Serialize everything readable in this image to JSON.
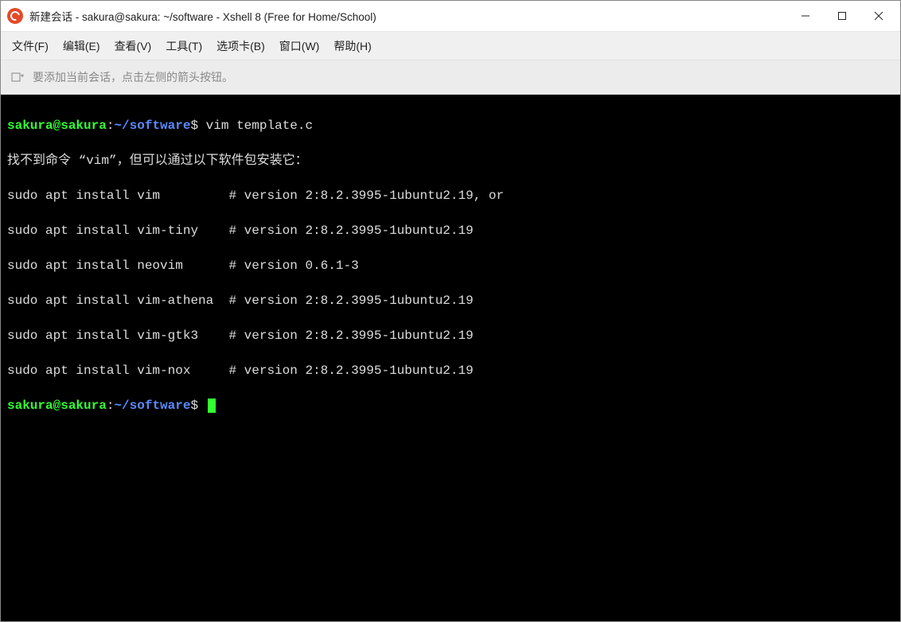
{
  "window": {
    "title": "新建会话 - sakura@sakura: ~/software - Xshell 8 (Free for Home/School)"
  },
  "menu": {
    "file": "文件(F)",
    "edit": "编辑(E)",
    "view": "查看(V)",
    "tools": "工具(T)",
    "tabs": "选项卡(B)",
    "window": "窗口(W)",
    "help": "帮助(H)"
  },
  "tabbar": {
    "hint": "要添加当前会话，点击左侧的箭头按钮。"
  },
  "prompt": {
    "userhost": "sakura@sakura",
    "sep": ":",
    "path": "~/software",
    "sign": "$"
  },
  "terminal": {
    "cmd1": "vim template.c",
    "errline": "找不到命令 “vim”，但可以通过以下软件包安装它：",
    "lines": [
      "sudo apt install vim         # version 2:8.2.3995-1ubuntu2.19, or",
      "sudo apt install vim-tiny    # version 2:8.2.3995-1ubuntu2.19",
      "sudo apt install neovim      # version 0.6.1-3",
      "sudo apt install vim-athena  # version 2:8.2.3995-1ubuntu2.19",
      "sudo apt install vim-gtk3    # version 2:8.2.3995-1ubuntu2.19",
      "sudo apt install vim-nox     # version 2:8.2.3995-1ubuntu2.19"
    ]
  }
}
